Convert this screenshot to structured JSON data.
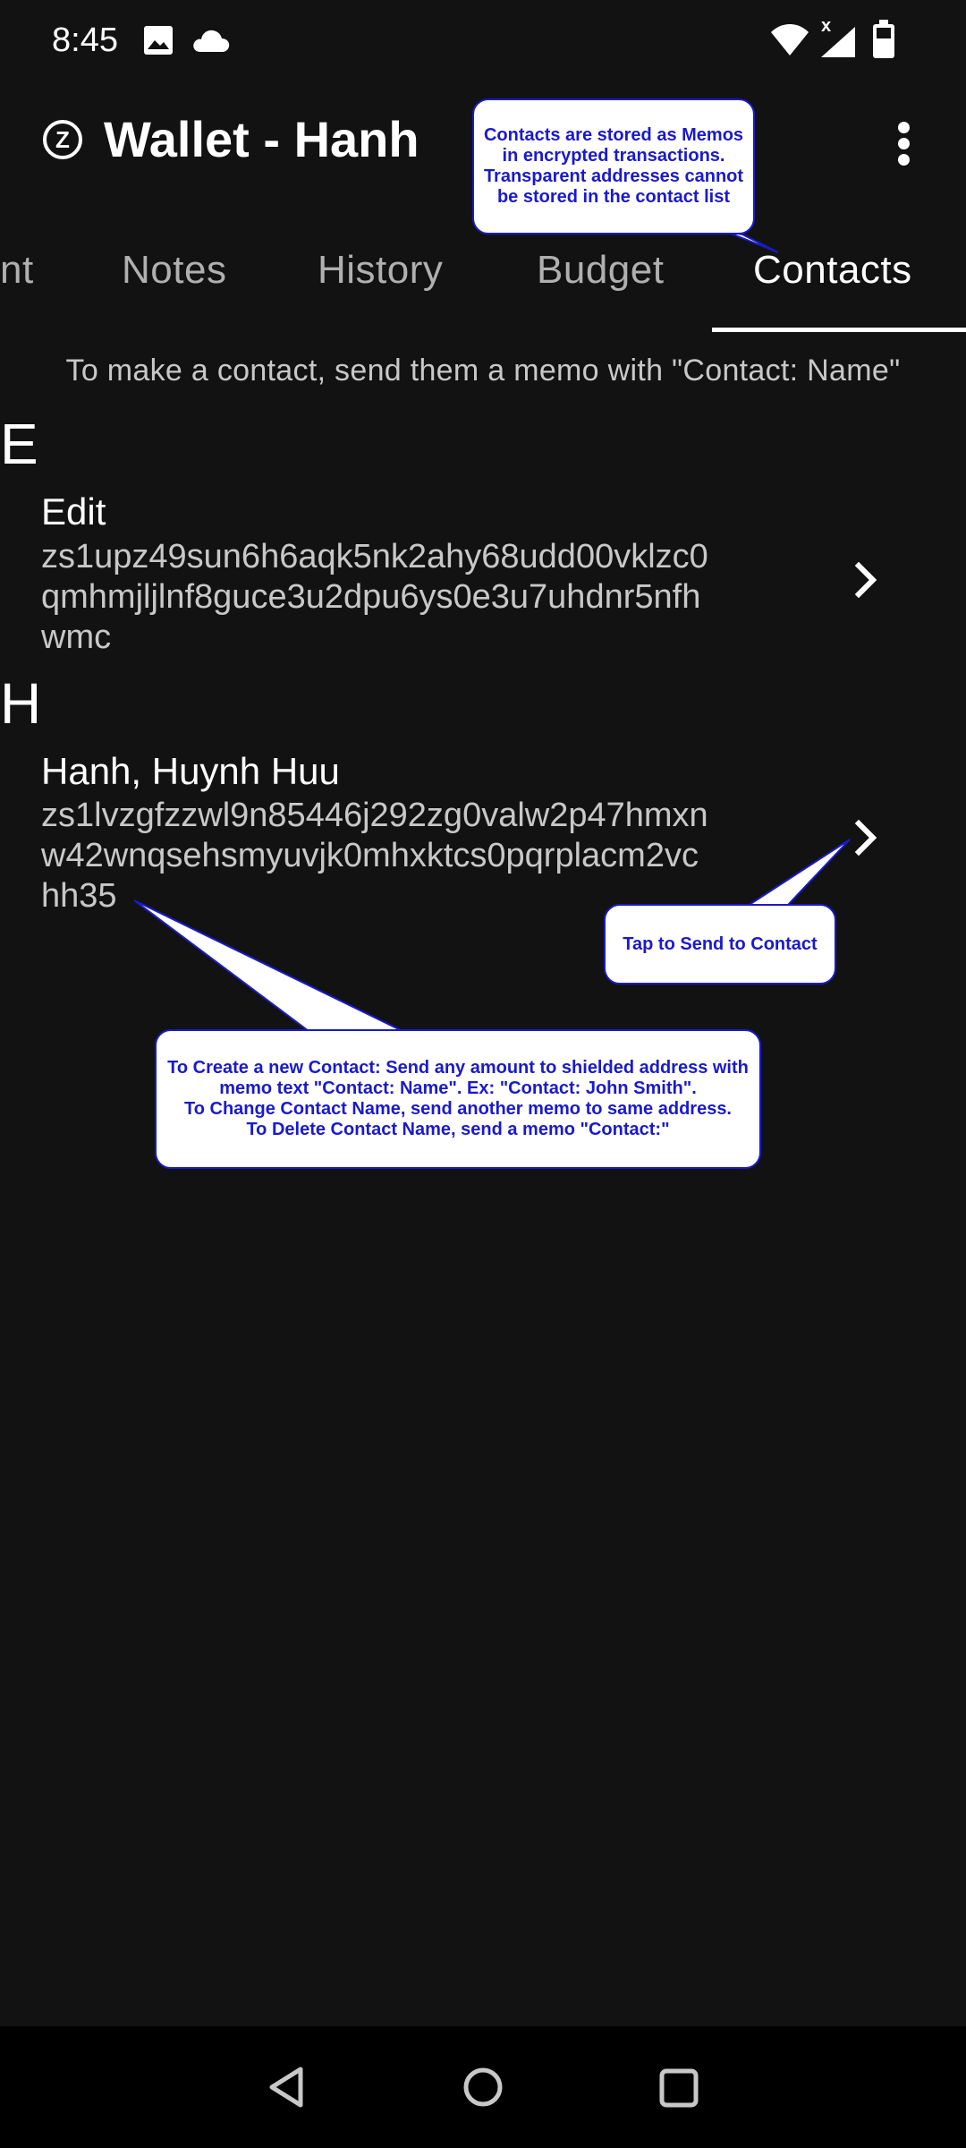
{
  "status_bar": {
    "time": "8:45",
    "icons": [
      "image-icon",
      "cloud-icon",
      "wifi-icon",
      "signal-icon",
      "battery-icon"
    ]
  },
  "app_bar": {
    "logo_letter": "Z",
    "title": "Wallet - Hanh",
    "menu_icon": "more-vert-icon"
  },
  "tabs": [
    {
      "label": "nt",
      "active": false
    },
    {
      "label": "Notes",
      "active": false
    },
    {
      "label": "History",
      "active": false
    },
    {
      "label": "Budget",
      "active": false
    },
    {
      "label": "Contacts",
      "active": true
    }
  ],
  "hint": "To make a contact, send them a memo with \"Contact: Name\"",
  "sections": [
    {
      "letter": "E",
      "contact": {
        "name": "Edit",
        "address_lines": [
          "zs1upz49sun6h6aqk5nk2ahy68udd00vklzc0",
          "qmhmjljlnf8guce3u2dpu6ys0e3u7uhdnr5nfh",
          "wmc"
        ]
      }
    },
    {
      "letter": "H",
      "contact": {
        "name": "Hanh, Huynh Huu",
        "address_lines": [
          "zs1lvzgfzzwl9n85446j292zg0valw2p47hmxn",
          "w42wnqsehsmyuvjk0mhxktcs0pqrplacm2vc",
          "hh35"
        ]
      }
    }
  ],
  "callouts": {
    "contacts_memo": "Contacts are stored as Memos in encrypted transactions. Transparent addresses cannot be stored in the contact list",
    "tap_to_send": "Tap to Send to Contact",
    "create_contact": "To Create a new Contact: Send any amount to shielded address with memo text \"Contact: Name\". Ex: \"Contact: John Smith\".\nTo Change Contact Name, send another memo to same address.\nTo Delete Contact Name, send a memo \"Contact:\""
  },
  "nav_bar": {
    "icons": [
      "back-icon",
      "home-icon",
      "recents-icon"
    ]
  },
  "colors": {
    "background": "#121212",
    "callout_text": "#1a1acc",
    "callout_bg": "#ffffff",
    "tab_inactive": "#b0b0b0",
    "address_text": "#c8c8c8"
  }
}
